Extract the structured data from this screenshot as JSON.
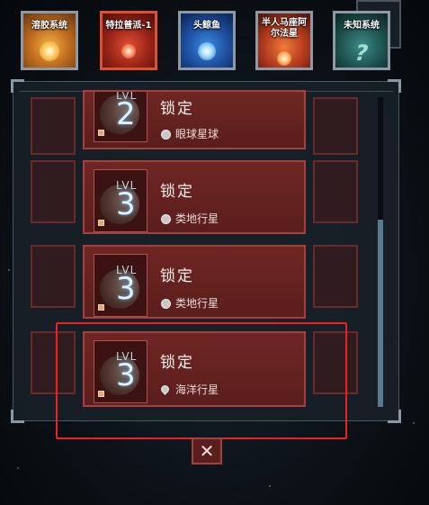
{
  "systems": [
    {
      "label": "溶胶系统"
    },
    {
      "label": "特拉普派-1"
    },
    {
      "label": "头鲸鱼"
    },
    {
      "label": "半人马座阿尔法星"
    },
    {
      "label": "未知系统"
    }
  ],
  "cards": [
    {
      "lvl_label": "LVL",
      "level": "2",
      "status": "锁定",
      "type": "眼球星球",
      "type_icon": "eyeball-icon"
    },
    {
      "lvl_label": "LVL",
      "level": "3",
      "status": "锁定",
      "type": "类地行星",
      "type_icon": "terrestrial-icon"
    },
    {
      "lvl_label": "LVL",
      "level": "3",
      "status": "锁定",
      "type": "类地行星",
      "type_icon": "terrestrial-icon"
    },
    {
      "lvl_label": "LVL",
      "level": "3",
      "status": "锁定",
      "type": "海洋行星",
      "type_icon": "water-drop-icon"
    }
  ],
  "close_label": "✕",
  "colors": {
    "highlight": "#ee2020",
    "card_border": "#a2413d",
    "selected_tab": "#e0502f"
  }
}
